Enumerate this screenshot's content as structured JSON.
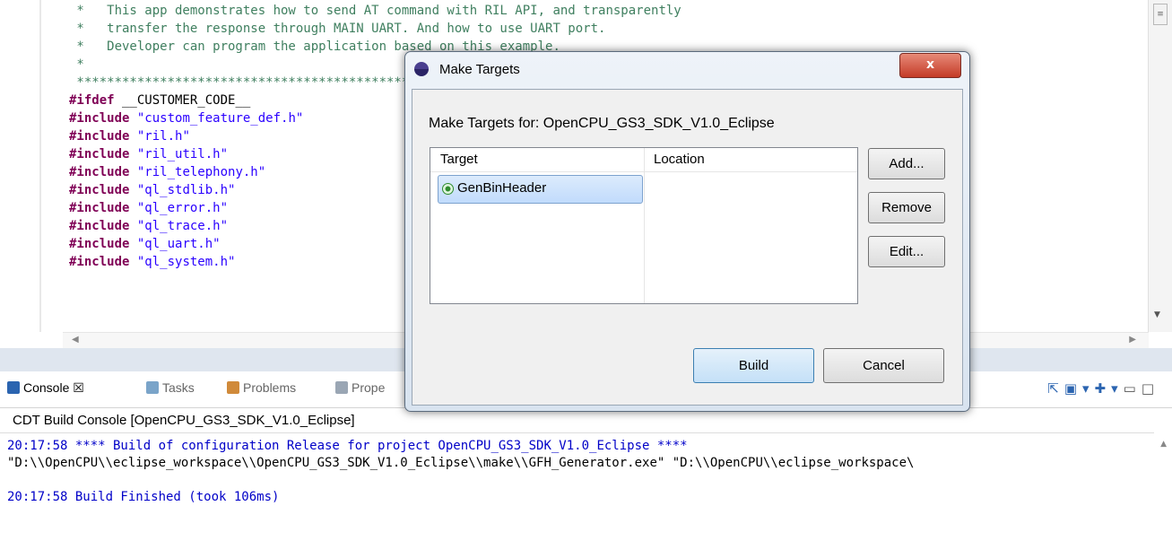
{
  "editor": {
    "code_lines": [
      {
        "parts": [
          {
            "c": "cm",
            "t": " *   This app demonstrates how to send AT command with RIL API, and transparently"
          }
        ]
      },
      {
        "parts": [
          {
            "c": "cm",
            "t": " *   transfer the response through MAIN UART. And how to use UART port."
          }
        ]
      },
      {
        "parts": [
          {
            "c": "cm",
            "t": " *   Developer can program the application based on this example."
          }
        ]
      },
      {
        "parts": [
          {
            "c": "cm",
            "t": " *"
          }
        ]
      },
      {
        "parts": [
          {
            "c": "cm",
            "t": " *****************************************************"
          }
        ]
      },
      {
        "parts": [
          {
            "c": "kw",
            "t": "#ifdef"
          },
          {
            "c": "",
            "t": " __CUSTOMER_CODE__"
          }
        ]
      },
      {
        "parts": [
          {
            "c": "kw",
            "t": "#include"
          },
          {
            "c": "st",
            "t": " \"custom_feature_def.h\""
          }
        ]
      },
      {
        "parts": [
          {
            "c": "kw",
            "t": "#include"
          },
          {
            "c": "st",
            "t": " \"ril.h\""
          }
        ]
      },
      {
        "parts": [
          {
            "c": "kw",
            "t": "#include"
          },
          {
            "c": "st",
            "t": " \"ril_util.h\""
          }
        ]
      },
      {
        "parts": [
          {
            "c": "kw",
            "t": "#include"
          },
          {
            "c": "st",
            "t": " \"ril_telephony.h\""
          }
        ]
      },
      {
        "parts": [
          {
            "c": "kw",
            "t": "#include"
          },
          {
            "c": "st",
            "t": " \"ql_stdlib.h\""
          }
        ]
      },
      {
        "parts": [
          {
            "c": "kw",
            "t": "#include"
          },
          {
            "c": "st",
            "t": " \"ql_error.h\""
          }
        ]
      },
      {
        "parts": [
          {
            "c": "kw",
            "t": "#include"
          },
          {
            "c": "st",
            "t": " \"ql_trace.h\""
          }
        ]
      },
      {
        "parts": [
          {
            "c": "kw",
            "t": "#include"
          },
          {
            "c": "st",
            "t": " \"ql_uart.h\""
          }
        ]
      },
      {
        "parts": [
          {
            "c": "kw",
            "t": "#include"
          },
          {
            "c": "st",
            "t": " \"ql_system.h\""
          }
        ]
      }
    ]
  },
  "console": {
    "tabs": {
      "console": "Console ☒",
      "tasks": "Tasks",
      "problems": "Problems",
      "properties": "Prope"
    },
    "toolbar_icons": [
      "pin-console-icon",
      "display-console-icon",
      "open-console-icon",
      "minimize-icon",
      "maximize-icon"
    ],
    "title": "CDT Build Console [OpenCPU_GS3_SDK_V1.0_Eclipse]",
    "lines": [
      {
        "c": "blue",
        "t": "20:17:58 **** Build of configuration Release for project OpenCPU_GS3_SDK_V1.0_Eclipse ****"
      },
      {
        "c": "black",
        "t": "\"D:\\\\OpenCPU\\\\eclipse_workspace\\\\OpenCPU_GS3_SDK_V1.0_Eclipse\\\\make\\\\GFH_Generator.exe\" \"D:\\\\OpenCPU\\\\eclipse_workspace\\"
      },
      {
        "c": "black",
        "t": " "
      },
      {
        "c": "blue",
        "t": "20:17:58 Build Finished (took 106ms)"
      }
    ]
  },
  "dialog": {
    "title": "Make Targets",
    "close_label": "x",
    "heading": "Make Targets for: OpenCPU_GS3_SDK_V1.0_Eclipse",
    "columns": {
      "target": "Target",
      "location": "Location"
    },
    "rows": [
      {
        "target": "GenBinHeader",
        "location": ""
      }
    ],
    "buttons": {
      "add": "Add...",
      "remove": "Remove",
      "edit": "Edit...",
      "build": "Build",
      "cancel": "Cancel"
    }
  },
  "colors": {
    "comment": "#3f7f5f",
    "keyword": "#7f0055",
    "string": "#2a00ff",
    "console_blue": "#0000c8"
  }
}
